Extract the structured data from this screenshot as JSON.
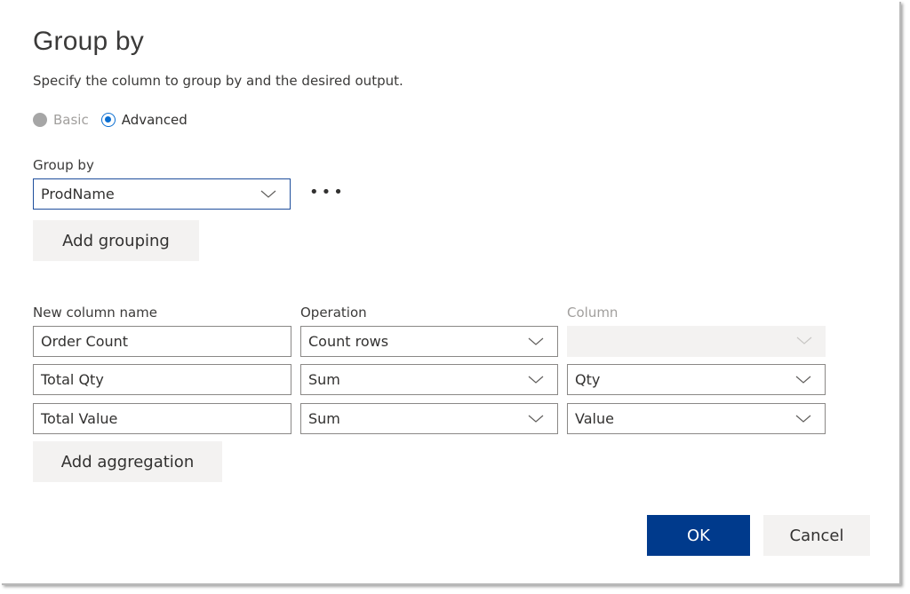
{
  "dialog": {
    "title": "Group by",
    "subtitle": "Specify the column to group by and the desired output.",
    "mode": {
      "options": [
        {
          "label": "Basic",
          "state": "disabled"
        },
        {
          "label": "Advanced",
          "state": "checked"
        }
      ]
    },
    "group_by": {
      "label": "Group by",
      "value": "ProdName",
      "more_icon": "ellipsis-icon",
      "add_button": "Add grouping"
    },
    "aggregations": {
      "headers": {
        "new_column_name": "New column name",
        "operation": "Operation",
        "column": "Column"
      },
      "rows": [
        {
          "name": "Order Count",
          "operation": "Count rows",
          "column": ""
        },
        {
          "name": "Total Qty",
          "operation": "Sum",
          "column": "Qty"
        },
        {
          "name": "Total Value",
          "operation": "Sum",
          "column": "Value"
        }
      ],
      "add_button": "Add aggregation"
    },
    "footer": {
      "ok": "OK",
      "cancel": "Cancel"
    },
    "colors": {
      "primary": "#003a8c",
      "radio_accent": "#0a6ed1",
      "focus_border": "#1e4e9c"
    }
  }
}
